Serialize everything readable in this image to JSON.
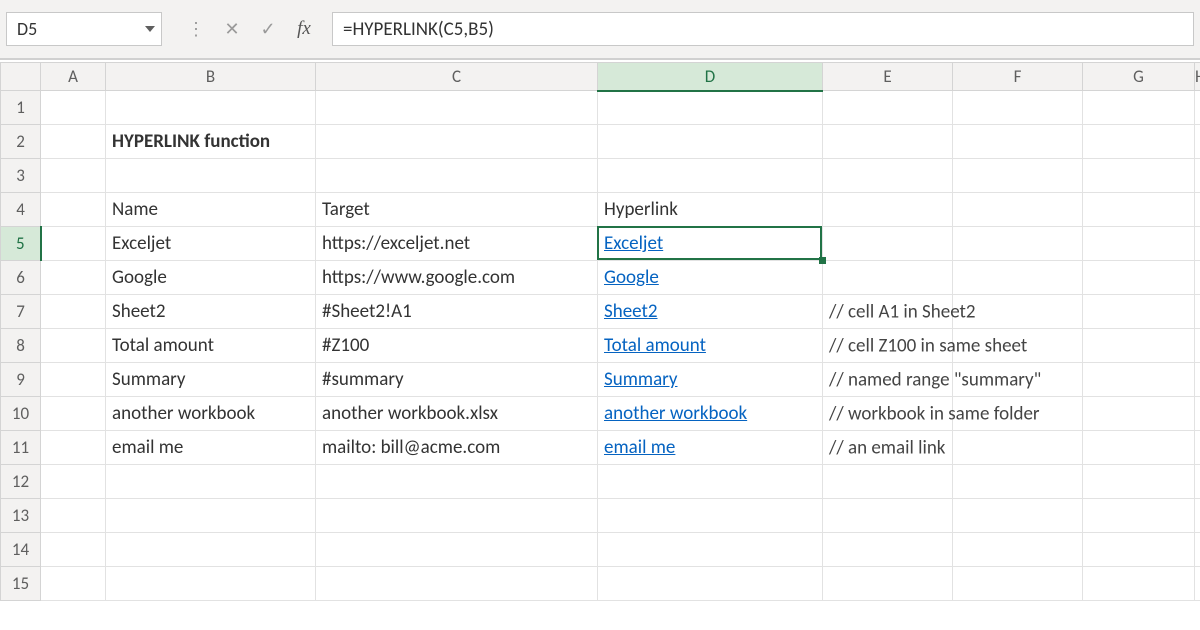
{
  "formula_bar": {
    "cell_ref": "D5",
    "formula": "=HYPERLINK(C5,B5)"
  },
  "columns": [
    "A",
    "B",
    "C",
    "D",
    "E",
    "F",
    "G",
    "H"
  ],
  "rows_count": 15,
  "selected_col_index": 3,
  "selected_row_index": 4,
  "title": "HYPERLINK function",
  "table": {
    "headers": {
      "name": "Name",
      "target": "Target",
      "hyperlink": "Hyperlink"
    },
    "rows": [
      {
        "name": "Exceljet",
        "target": "https://exceljet.net",
        "link": "Exceljet",
        "comment": ""
      },
      {
        "name": "Google",
        "target": "https://www.google.com",
        "link": "Google",
        "comment": ""
      },
      {
        "name": "Sheet2",
        "target": "#Sheet2!A1",
        "link": "Sheet2",
        "comment": "// cell A1 in  Sheet2"
      },
      {
        "name": "Total amount",
        "target": "#Z100",
        "link": "Total amount",
        "comment": "// cell Z100 in same sheet"
      },
      {
        "name": "Summary",
        "target": "#summary",
        "link": "Summary",
        "comment": "// named range \"summary\""
      },
      {
        "name": "another workbook",
        "target": "another workbook.xlsx",
        "link": "another workbook",
        "comment": "// workbook in same folder"
      },
      {
        "name": "email me",
        "target": "mailto: bill@acme.com",
        "link": "email me",
        "comment": "// an email link"
      }
    ]
  }
}
